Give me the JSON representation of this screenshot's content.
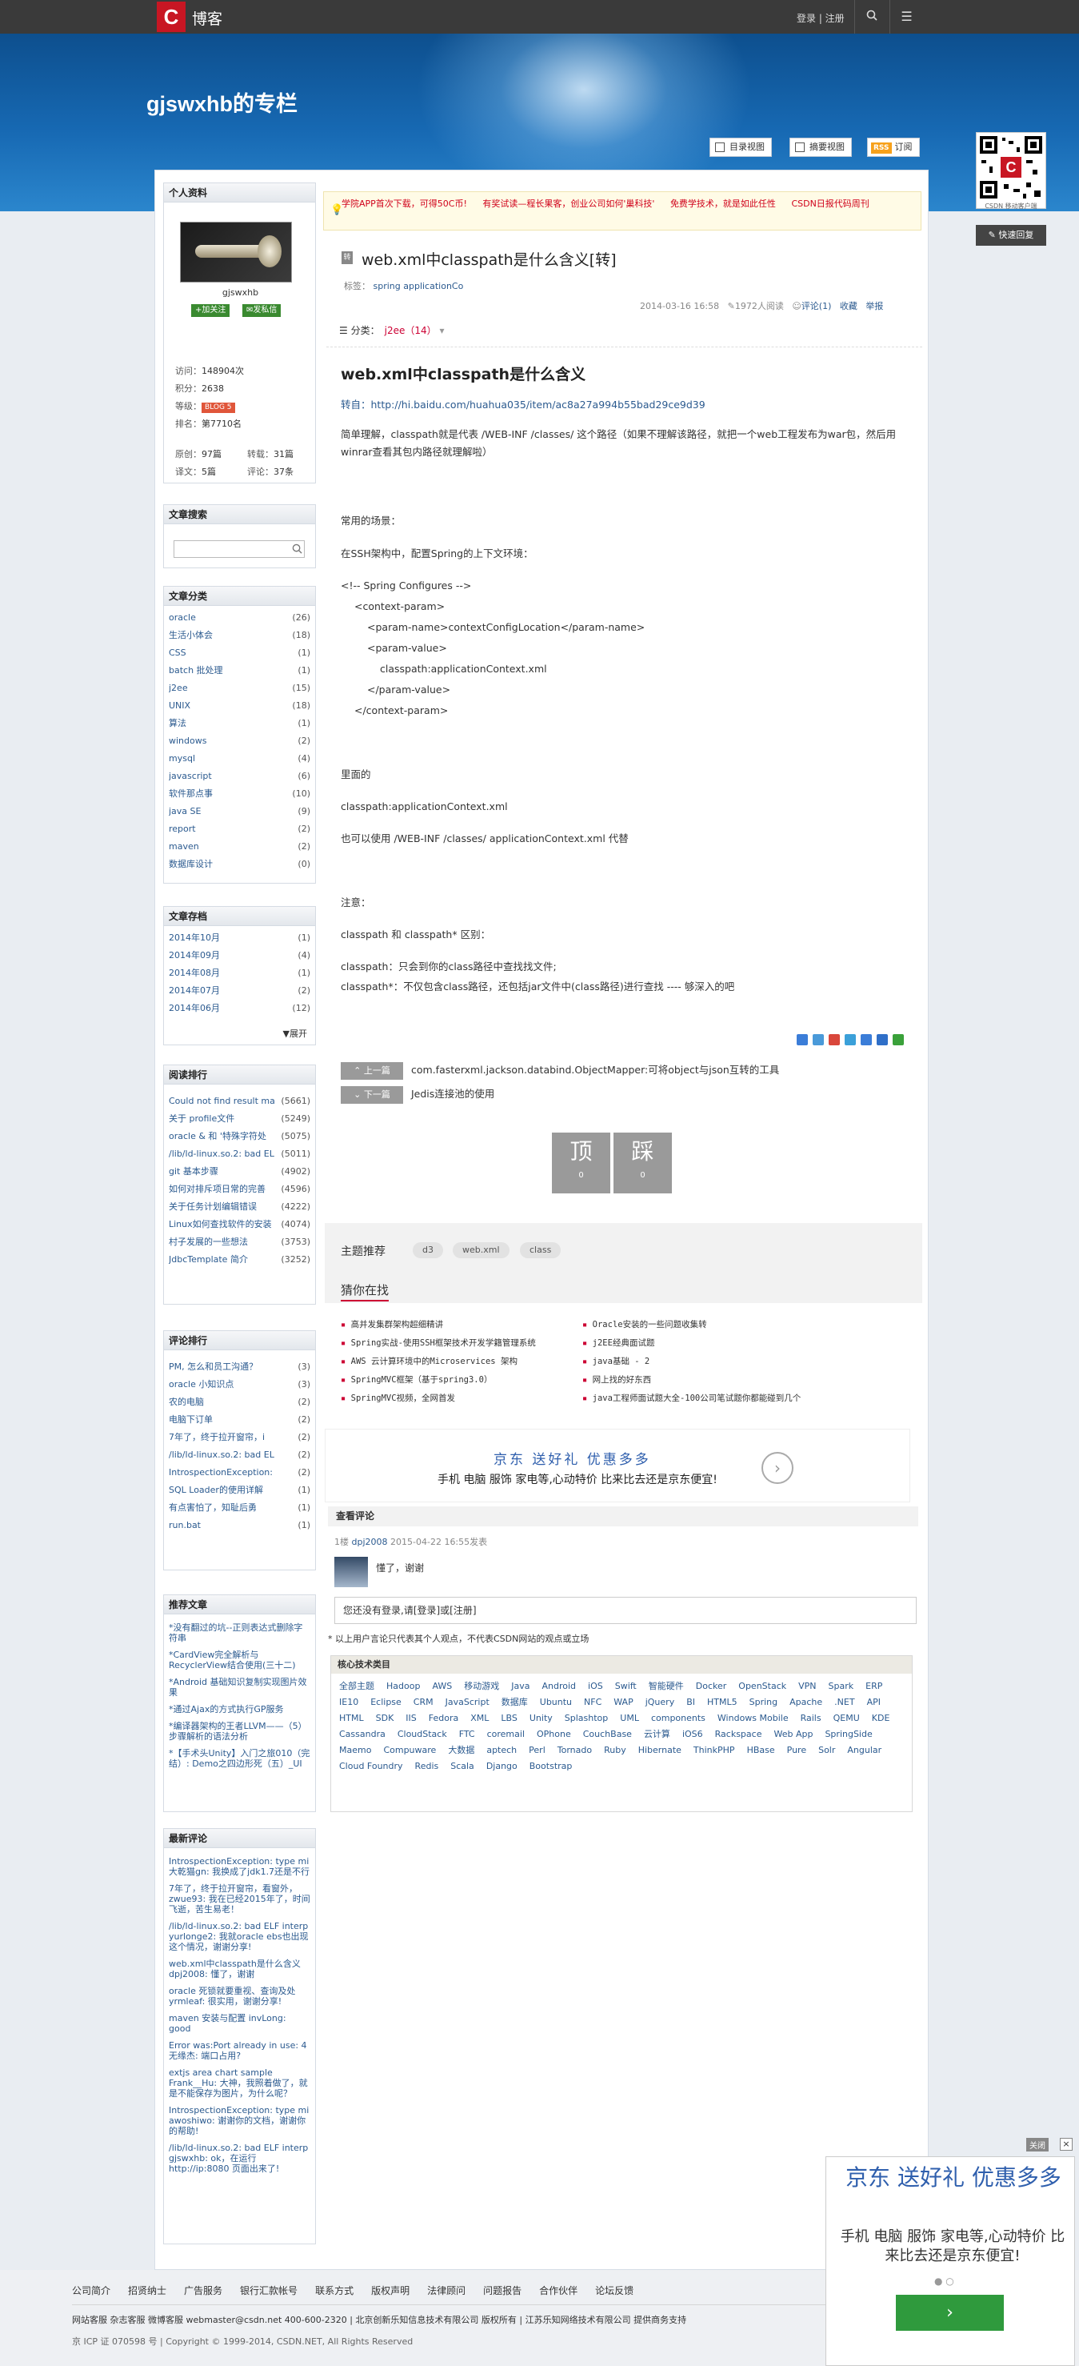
{
  "topbar": {
    "logo": "C",
    "brand": "博客",
    "login": "登录 | 注册",
    "search_icon": "search-icon",
    "menu_icon": "hamburger-menu-icon"
  },
  "header": {
    "blog_title": "gjswxhb的专栏",
    "view_buttons": [
      "目录视图",
      "摘要视图"
    ],
    "rss_badge": "RSS",
    "rss_label": "订阅",
    "qr_label": "CSDN 移动客户端",
    "quick_reply": "快速回复"
  },
  "profile": {
    "panel_title": "个人资料",
    "username": "gjswxhb",
    "follow": "+加关注",
    "message": "✉发私信",
    "visits_label": "访问：",
    "visits": "148904次",
    "points_label": "积分：",
    "points": "2638",
    "level_label": "等级：",
    "level": "BLOG 5",
    "rank_label": "排名：",
    "rank": "第7710名",
    "original_label": "原创：",
    "original": "97篇",
    "repost_label": "转载：",
    "repost": "31篇",
    "translate_label": "译文：",
    "translate": "5篇",
    "comments_label": "评论：",
    "comments": "37条"
  },
  "search": {
    "title": "文章搜索"
  },
  "categories": {
    "title": "文章分类",
    "items": [
      {
        "t": "oracle",
        "c": "(26)"
      },
      {
        "t": "生活小体会",
        "c": "(18)"
      },
      {
        "t": "CSS",
        "c": "(1)"
      },
      {
        "t": "batch 批处理",
        "c": "(1)"
      },
      {
        "t": "j2ee",
        "c": "(15)"
      },
      {
        "t": "UNIX",
        "c": "(18)"
      },
      {
        "t": "算法",
        "c": "(1)"
      },
      {
        "t": "windows",
        "c": "(2)"
      },
      {
        "t": "mysql",
        "c": "(4)"
      },
      {
        "t": "javascript",
        "c": "(6)"
      },
      {
        "t": "软件那点事",
        "c": "(10)"
      },
      {
        "t": "java SE",
        "c": "(9)"
      },
      {
        "t": "report",
        "c": "(2)"
      },
      {
        "t": "maven",
        "c": "(2)"
      },
      {
        "t": "数据库设计",
        "c": "(0)"
      }
    ]
  },
  "archive": {
    "title": "文章存档",
    "items": [
      {
        "t": "2014年10月",
        "c": "(1)"
      },
      {
        "t": "2014年09月",
        "c": "(4)"
      },
      {
        "t": "2014年08月",
        "c": "(1)"
      },
      {
        "t": "2014年07月",
        "c": "(2)"
      },
      {
        "t": "2014年06月",
        "c": "(12)"
      }
    ],
    "expand": "▼展开"
  },
  "ranking": {
    "title": "阅读排行",
    "items": [
      {
        "t": "Could not find result ma",
        "c": "(5661)"
      },
      {
        "t": "关于 profile文件",
        "c": "(5249)"
      },
      {
        "t": "oracle & 和 '特殊字符处",
        "c": "(5075)"
      },
      {
        "t": "/lib/ld-linux.so.2: bad EL",
        "c": "(5011)"
      },
      {
        "t": "git 基本步骤",
        "c": "(4902)"
      },
      {
        "t": "如何对排斥项日常的完善",
        "c": "(4596)"
      },
      {
        "t": "关于任务计划编辑错误",
        "c": "(4222)"
      },
      {
        "t": "Linux如何查找软件的安装",
        "c": "(4074)"
      },
      {
        "t": "村子发展的一些想法",
        "c": "(3753)"
      },
      {
        "t": "JdbcTemplate 简介",
        "c": "(3252)"
      }
    ]
  },
  "comment_rank": {
    "title": "评论排行",
    "items": [
      {
        "t": "PM, 怎么和员工沟通？",
        "c": "(3)"
      },
      {
        "t": "oracle 小知识点",
        "c": "(3)"
      },
      {
        "t": "农的电脑",
        "c": "(2)"
      },
      {
        "t": "电脑下订单",
        "c": "(2)"
      },
      {
        "t": "7年了，终于拉开窗帘，i",
        "c": "(2)"
      },
      {
        "t": "/lib/ld-linux.so.2: bad EL",
        "c": "(2)"
      },
      {
        "t": "IntrospectionException:",
        "c": "(2)"
      },
      {
        "t": "SQL Loader的使用详解",
        "c": "(1)"
      },
      {
        "t": "有点害怕了，知耻后勇",
        "c": "(1)"
      },
      {
        "t": "run.bat",
        "c": "(1)"
      }
    ]
  },
  "recommended": {
    "title": "推荐文章",
    "items": [
      "*没有翻过的坑--正则表达式删除字符串",
      "*CardView完全解析与RecyclerView结合使用(三十二)",
      "*Android 基础知识复制实现图片效果",
      "*通过Ajax的方式执行GP服务",
      "*编译器架构的王者LLVM——（5）步骤解析的语法分析",
      "*【手术头Unity】入门之旅010（完结）: Demo之四边形死（五）_UI"
    ]
  },
  "latest_comments": {
    "title": "最新评论",
    "items": [
      "IntrospectionException: type mi 大乾猫gn: 我换成了jdk1.7还是不行",
      "7年了，终于拉开窗帘，看窗外，zwue93: 我在已经2015年了，时间飞逝，苦生易老！",
      "/lib/ld-linux.so.2: bad ELF interp yurlonge2: 我就oracle ebs也出现这个情况，谢谢分享!",
      "web.xml中classpath是什么含义 dpj2008: 懂了，谢谢",
      "oracle 死锁就要重视、查询及处 yrmleaf: 很实用，谢谢分享!",
      "maven 安装与配置 invLong: good",
      "Error was:Port already in use: 4 无缘杰: 端口占用?",
      "extjs area chart sample Frank__Hu: 大神，我照着做了，就是不能保存为图片，为什么呢？",
      "IntrospectionException: type mi awoshiwo: 谢谢你的文档，谢谢你的帮助!",
      "/lib/ld-linux.so.2: bad ELF interp gjswxhb: ok，在运行 http://ip:8080 页面出来了!"
    ]
  },
  "notice": {
    "items": [
      "学院APP首次下载，可得50C币!",
      "有奖试读—程长果客，创业公司如何'巢科技'",
      "免费学技术，就是如此任性",
      "CSDN日报代码周刊"
    ]
  },
  "article": {
    "title": "web.xml中classpath是什么含义[转]",
    "tags_label": "标签：",
    "tags": "spring applicationCo",
    "date": "2014-03-16 16:58",
    "reads": "1972人阅读",
    "comments": "评论(1)",
    "collect": "收藏",
    "report": "举报",
    "category_label": "分类：",
    "category": "j2ee（14）",
    "h2": "web.xml中classpath是什么含义",
    "source": "转自：http://hi.baidu.com/huahua035/item/ac8a27a994b55bad29ce9d39",
    "p1": "简单理解，classpath就是代表 /WEB-INF /classes/ 这个路径（如果不理解该路径，就把一个web工程发布为war包，然后用winrar查看其包内路径就理解啦）",
    "p2": "常用的场景：",
    "p3": "在SSH架构中，配置Spring的上下文环境：",
    "code": [
      "<!-- Spring Configures -->",
      "<context-param>",
      "<param-name>contextConfigLocation</param-name>",
      "<param-value>",
      "classpath:applicationContext.xml",
      "</param-value>",
      "</context-param>"
    ],
    "p4": "里面的",
    "p5": "classpath:applicationContext.xml",
    "p6": "也可以使用 /WEB-INF /classes/ applicationContext.xml 代替",
    "p7": "注意：",
    "p8": "classpath 和 classpath* 区别：",
    "p9": "classpath：只会到你的class路径中查找找文件;",
    "p10": "classpath*：不仅包含class路径，还包括jar文件中(class路径)进行查找 ---- 够深入的吧",
    "prev_label": "⌃ 上一篇",
    "prev": "com.fasterxml.jackson.databind.ObjectMapper:可将object与json互转的工具",
    "next_label": "⌄ 下一篇",
    "next": "Jedis连接池的使用",
    "up": "顶",
    "up_n": "0",
    "down": "踩",
    "down_n": "0"
  },
  "topics": {
    "label": "主题推荐",
    "tags": [
      "d3",
      "web.xml",
      "class"
    ],
    "guess_title": "猜你在找",
    "left": [
      "高并发集群架构超细精讲",
      "Spring实战-使用SSH框架技术开发学籍管理系统",
      "AWS 云计算环境中的Microservices 架构",
      "SpringMVC框架（基于spring3.0）",
      "SpringMVC视频，全网首发"
    ],
    "right": [
      "Oracle安装的一些问题收集转",
      "j2EE经典面试题",
      "java基础 - 2",
      "网上找的好东西",
      "java工程师面试题大全-100公司笔试题你都能碰到几个"
    ]
  },
  "jd_ad": {
    "headline": "京东 送好礼 优惠多多",
    "sub": "手机 电脑 服饰 家电等,心动特价 比来比去还是京东便宜!",
    "arrow": "›"
  },
  "comments_section": {
    "title": "查看评论",
    "floor": "1楼",
    "user": "dpj2008",
    "time": "2015-04-22 16:55发表",
    "text": "懂了，谢谢",
    "login_prompt": "您还没有登录,请[登录]或[注册]",
    "disclaimer": "* 以上用户言论只代表其个人观点，不代表CSDN网站的观点或立场"
  },
  "tech": {
    "title": "核心技术类目",
    "items": [
      "全部主题",
      "Hadoop",
      "AWS",
      "移动游戏",
      "Java",
      "Android",
      "iOS",
      "Swift",
      "智能硬件",
      "Docker",
      "OpenStack",
      "VPN",
      "Spark",
      "ERP",
      "IE10",
      "Eclipse",
      "CRM",
      "JavaScript",
      "数据库",
      "Ubuntu",
      "NFC",
      "WAP",
      "jQuery",
      "BI",
      "HTML5",
      "Spring",
      "Apache",
      ".NET",
      "API",
      "HTML",
      "SDK",
      "IIS",
      "Fedora",
      "XML",
      "LBS",
      "Unity",
      "Splashtop",
      "UML",
      "components",
      "Windows Mobile",
      "Rails",
      "QEMU",
      "KDE",
      "Cassandra",
      "CloudStack",
      "FTC",
      "coremail",
      "OPhone",
      "CouchBase",
      "云计算",
      "iOS6",
      "Rackspace",
      "Web App",
      "SpringSide",
      "Maemo",
      "Compuware",
      "大数据",
      "aptech",
      "Perl",
      "Tornado",
      "Ruby",
      "Hibernate",
      "ThinkPHP",
      "HBase",
      "Pure",
      "Solr",
      "Angular",
      "Cloud Foundry",
      "Redis",
      "Scala",
      "Django",
      "Bootstrap"
    ]
  },
  "footer": {
    "links": [
      "公司简介",
      "招贤纳士",
      "广告服务",
      "银行汇款帐号",
      "联系方式",
      "版权声明",
      "法律顾问",
      "问题报告",
      "合作伙伴",
      "论坛反馈"
    ],
    "contact": "网站客服   杂志客服   微博客服   webmaster@csdn.net   400-600-2320 | 北京创新乐知信息技术有限公司 版权所有 | 江苏乐知网络技术有限公司 提供商务支持",
    "copyright": "京 ICP 证 070598 号  |  Copyright © 1999-2014, CSDN.NET, All Rights Reserved"
  },
  "side_ad": {
    "close": "关闭",
    "x": "×",
    "headline": "京东 送好礼 优惠多多",
    "sub": "手机 电脑 服饰 家电等,心动特价 比来比去还是京东便宜!",
    "btn": "›"
  }
}
